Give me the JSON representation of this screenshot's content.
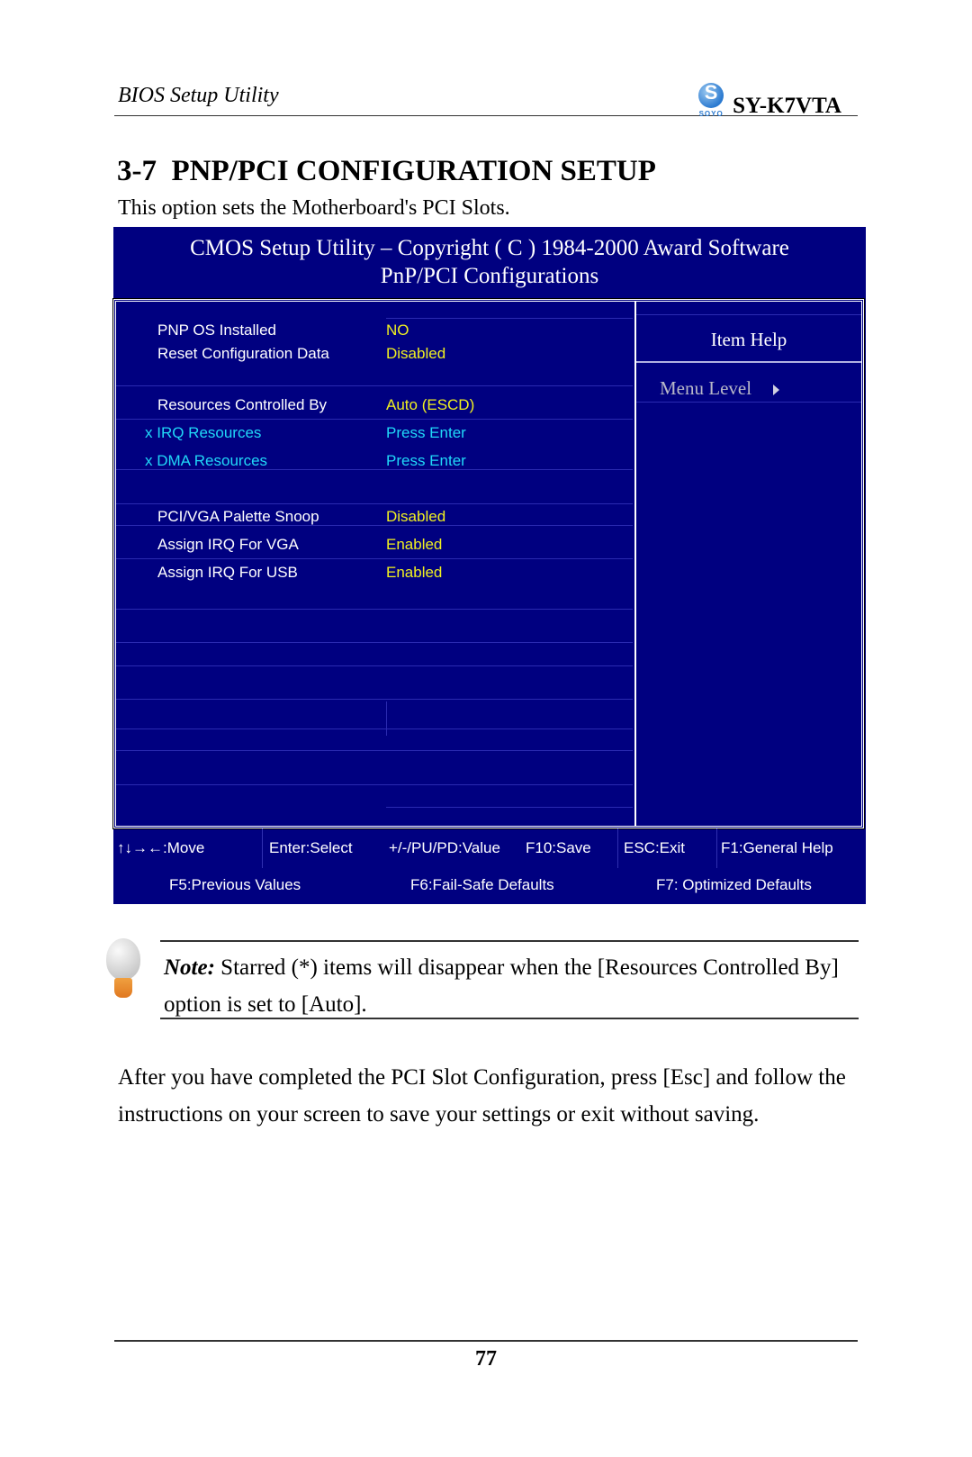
{
  "page_header": {
    "left_title": "BIOS Setup Utility",
    "logo_letter": "S",
    "logo_brand": "SOYO",
    "model": "SY-K7VTA"
  },
  "section": {
    "number": "3-7",
    "title": "PNP/PCI CONFIGURATION SETUP",
    "intro": "This option sets the Motherboard's PCI Slots."
  },
  "bios": {
    "title_line1": "CMOS Setup Utility – Copyright ( C ) 1984-2000 Award Software",
    "title_line2": "PnP/PCI Configurations",
    "items": [
      {
        "label": "PNP OS Installed",
        "value": "NO"
      },
      {
        "label": "Reset Configuration Data",
        "value": "Disabled"
      },
      {
        "label": "Resources Controlled By",
        "value": "Auto (ESCD)"
      },
      {
        "label": "x IRQ Resources",
        "value": "Press Enter"
      },
      {
        "label": "x DMA Resources",
        "value": "Press Enter"
      },
      {
        "label": "PCI/VGA Palette Snoop",
        "value": "Disabled"
      },
      {
        "label": "Assign IRQ For VGA",
        "value": "Enabled"
      },
      {
        "label": "Assign IRQ For USB",
        "value": "Enabled"
      }
    ],
    "help": {
      "title": "Item Help",
      "menu_level": "Menu Level"
    },
    "keys_row1": [
      "↑↓→←:Move",
      "Enter:Select",
      "+/-/PU/PD:Value",
      "F10:Save",
      "ESC:Exit",
      "F1:General Help"
    ],
    "keys_row2": [
      "F5:Previous Values",
      "F6:Fail-Safe Defaults",
      "F7: Optimized Defaults"
    ],
    "colors": {
      "background": "#000080",
      "value": "#f0f020",
      "disabled_item": "#20d8f8",
      "label": "#ffffff"
    }
  },
  "note": {
    "prefix": "Note:",
    "text": " Starred (*) items will disappear when the [Resources Controlled By] option is set to [Auto]."
  },
  "body_text": "After you have completed the PCI Slot Configuration, press [Esc] and follow the instructions on your screen to save your settings or exit without saving.",
  "page_number": "77"
}
